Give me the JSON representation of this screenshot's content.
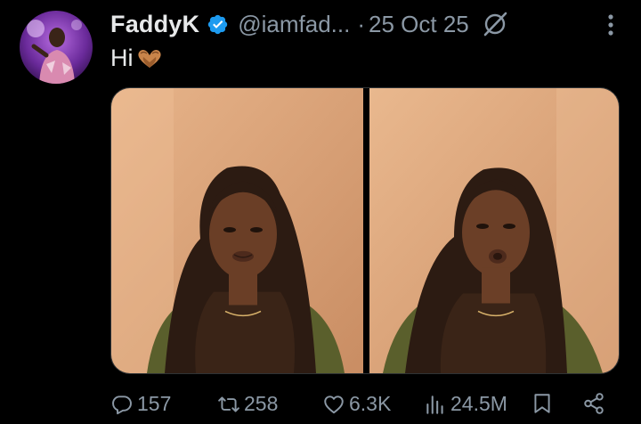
{
  "author": {
    "name": "FaddyK",
    "handle": "@iamfad...",
    "separator": "·",
    "date": "25 Oct 25",
    "verified": true
  },
  "tweet": {
    "text": "Hi"
  },
  "icons": {
    "verified": "verified-badge-icon",
    "grok": "grok-icon",
    "more": "more-options-icon",
    "emoji": "heart-hands-emoji",
    "reply": "reply-icon",
    "retweet": "retweet-icon",
    "like": "like-icon",
    "views": "views-icon",
    "bookmark": "bookmark-icon",
    "share": "share-icon"
  },
  "actions": {
    "replies": "157",
    "reposts": "258",
    "likes": "6.3K",
    "views": "24.5M"
  },
  "colors": {
    "background": "#000000",
    "text": "#e7e9ea",
    "muted": "#8b98a5",
    "verified": "#1d9bf0"
  }
}
